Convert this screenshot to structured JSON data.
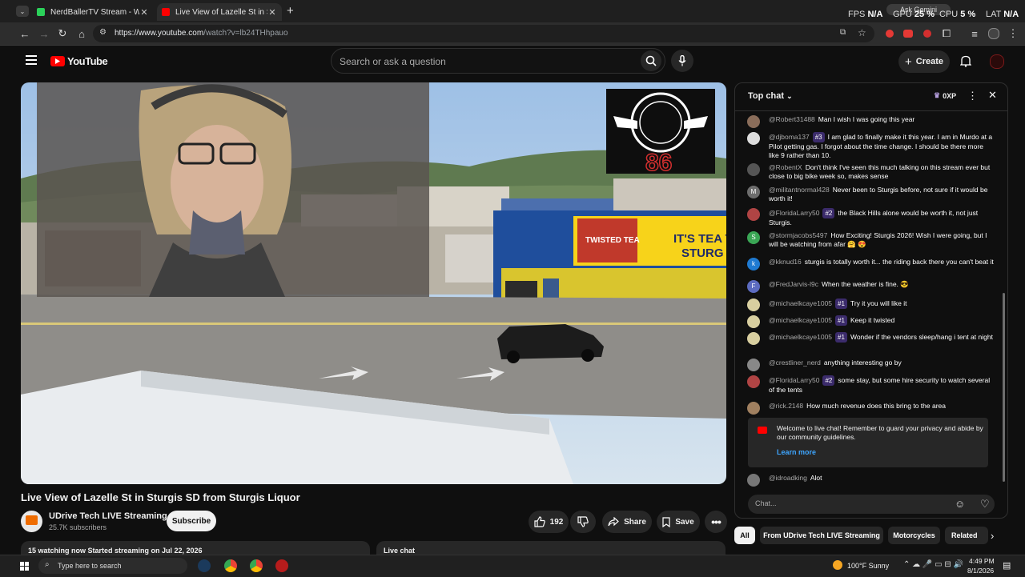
{
  "browser": {
    "tabs": [
      {
        "title": "NerdBallerTV Stream - Watch Li"
      },
      {
        "title": "Live View of Lazelle St in Sturgis"
      }
    ],
    "url_host": "https://www.youtube.com",
    "url_path": "/watch?v=lb24THhpauo",
    "ask_gemini": "Ask Gemini",
    "stats": {
      "fps_label": "FPS",
      "fps": "N/A",
      "gpu_label": "GPU",
      "gpu": "25 %",
      "cpu_label": "CPU",
      "cpu": "5 %",
      "lat_label": "LAT",
      "lat": "N/A"
    }
  },
  "youtube": {
    "logo_text": "YouTube",
    "search_placeholder": "Search or ask a question",
    "create_label": "Create"
  },
  "video": {
    "title": "Live View of Lazelle St in Sturgis SD from Sturgis Liquor",
    "channel": "UDrive Tech LIVE Streaming",
    "subscribers": "25.7K subscribers",
    "subscribe_label": "Subscribe",
    "likes": "192",
    "share_label": "Share",
    "save_label": "Save",
    "description_meta": "15 watching now  Started streaming on Jul 22, 2026",
    "live_chat_panel_label": "Live chat",
    "overlay_number": "86",
    "mural_text_1": "IT'S TEA TI",
    "mural_text_2": "STURG",
    "can_text": "TWISTED TEA"
  },
  "chat": {
    "mode": "Top chat",
    "xp": "0XP",
    "messages": [
      {
        "author": "@Robert31488",
        "text": "Man I wish I was going this year",
        "avatar_color": "#8a6d5a"
      },
      {
        "author": "@djboma137",
        "badge": "#3",
        "text": "I am glad to finally make it this year. I am in Murdo at a Pilot getting gas. I forgot about the time change. I should be there more like 9 rather than 10.",
        "avatar_color": "#dddddd"
      },
      {
        "author": "@RobentX",
        "text": "Don't think I've seen this much talking on this stream ever but close to big bike week so, makes sense",
        "avatar_color": "#555555"
      },
      {
        "author": "@militantnormal428",
        "text": "Never been to Sturgis before, not sure if it would be worth it!",
        "avatar_color": "#6d6d6d",
        "initial": "M"
      },
      {
        "author": "@FloridaLarry50",
        "badge": "#2",
        "text": "the Black Hills alone would be worth it, not just Sturgis.",
        "avatar_color": "#b04444"
      },
      {
        "author": "@stormjacobs5497",
        "text": "How Exciting! Sturgis 2026! Wish I were going, but I will be watching from afar 🤗 😍",
        "avatar_color": "#3aa655",
        "initial": "S"
      },
      {
        "author": "@kknud16",
        "text": "sturgis is totally worth it... the riding back there you can't beat it",
        "avatar_color": "#1f7ad1",
        "initial": "k"
      },
      {
        "author": "@FredJarvis-l9c",
        "text": "When the weather is fine. 😎",
        "avatar_color": "#5c6bc0",
        "initial": "F"
      },
      {
        "author": "@michaelkcaye1005",
        "badge": "#1",
        "text": "Try it you will like it",
        "avatar_color": "#d8cfa0"
      },
      {
        "author": "@michaelkcaye1005",
        "badge": "#1",
        "text": "Keep it twisted",
        "avatar_color": "#d8cfa0"
      },
      {
        "author": "@michaelkcaye1005",
        "badge": "#1",
        "text": "Wonder if the vendors sleep/hang i tent at night",
        "avatar_color": "#d8cfa0"
      },
      {
        "author": "@crestliner_nerd",
        "text": "anything interesting go by",
        "avatar_color": "#888888"
      },
      {
        "author": "@FloridaLarry50",
        "badge": "#2",
        "text": "some stay, but some hire security to watch several of the tents",
        "avatar_color": "#b04444"
      },
      {
        "author": "@rick.2148",
        "text": "How much revenue does this bring to the area",
        "avatar_color": "#a08060"
      }
    ],
    "welcome_text": "Welcome to live chat! Remember to guard your privacy and abide by our community guidelines.",
    "learn_more": "Learn more",
    "last_message": {
      "author": "@idroadking",
      "text": "Alot",
      "avatar_color": "#777777"
    },
    "input_placeholder": "Chat..."
  },
  "chips": [
    "All",
    "From UDrive Tech LIVE Streaming",
    "Motorcycles",
    "Related"
  ],
  "taskbar": {
    "search_placeholder": "Type here to search",
    "weather": "100°F  Sunny",
    "time": "4:49 PM",
    "date": "8/1/2026"
  }
}
